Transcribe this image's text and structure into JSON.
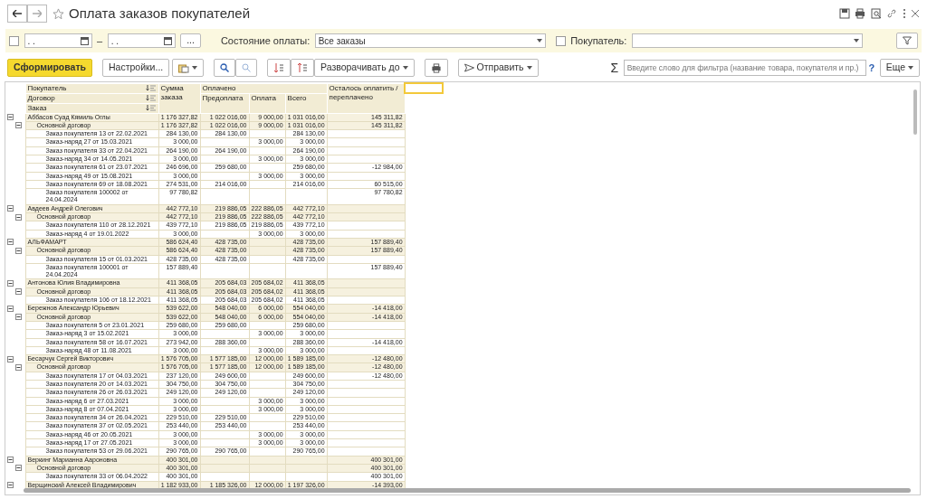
{
  "window": {
    "title": "Оплата заказов покупателей"
  },
  "filters": {
    "period_enabled": false,
    "date_from": ". .",
    "date_separator": "–",
    "period_button": "...",
    "payment_state_label": "Состояние оплаты:",
    "payment_state": "Все заказы",
    "customer_enabled": false,
    "customer_label": "Покупатель:"
  },
  "toolbar": {
    "generate": "Сформировать",
    "settings": "Настройки...",
    "expand_to": "Разворачивать до",
    "send": "Отправить",
    "sum_sign": "Σ",
    "search_placeholder": "Введите слово для фильтра (название товара, покупателя и пр.)",
    "help": "?",
    "more": "Еще"
  },
  "columns": {
    "grouping": [
      "Покупатель",
      "Договор",
      "Заказ"
    ],
    "order_sum": "Сумма заказа",
    "paid": "Оплачено",
    "paid_parts": [
      "Предоплата",
      "Оплата",
      "Всего"
    ],
    "remaining": "Осталось оплатить / переплачено"
  },
  "rows": [
    {
      "name": "Аббасов Суад Кямиль Оглы",
      "expanded": true,
      "sum": "1 176 327,82",
      "prepaid": "1 022 016,00",
      "paid": "9 000,00",
      "total": "1 031 016,00",
      "remaining": "145 311,82",
      "children": [
        {
          "name": "Основной договор",
          "expanded": true,
          "sum": "1 176 327,82",
          "prepaid": "1 022 016,00",
          "paid": "9 000,00",
          "total": "1 031 016,00",
          "remaining": "145 311,82",
          "children": [
            {
              "name": "Заказ покупателя 13 от 22.02.2021",
              "sum": "284 130,00",
              "prepaid": "284 130,00",
              "total": "284 130,00"
            },
            {
              "name": "Заказ-наряд 27 от 15.03.2021",
              "sum": "3 000,00",
              "paid": "3 000,00",
              "total": "3 000,00"
            },
            {
              "name": "Заказ покупателя 33 от 22.04.2021",
              "sum": "264 190,00",
              "prepaid": "264 190,00",
              "total": "264 190,00"
            },
            {
              "name": "Заказ-наряд 34 от 14.05.2021",
              "sum": "3 000,00",
              "paid": "3 000,00",
              "total": "3 000,00"
            },
            {
              "name": "Заказ покупателя 61 от 23.07.2021",
              "sum": "246 696,00",
              "prepaid": "259 680,00",
              "total": "259 680,00",
              "remaining": "-12 984,00"
            },
            {
              "name": "Заказ-наряд 49 от 15.08.2021",
              "sum": "3 000,00",
              "paid": "3 000,00",
              "total": "3 000,00"
            },
            {
              "name": "Заказ покупателя 69 от 18.08.2021",
              "sum": "274 531,00",
              "prepaid": "214 016,00",
              "total": "214 016,00",
              "remaining": "60 515,00"
            },
            {
              "name": "Заказ покупателя 100002 от 24.04.2024",
              "sum": "97 780,82",
              "remaining": "97 780,82"
            }
          ]
        }
      ]
    },
    {
      "name": "Авдеев Андрей Олегович",
      "expanded": true,
      "sum": "442 772,10",
      "prepaid": "219 886,05",
      "paid": "222 886,05",
      "total": "442 772,10",
      "children": [
        {
          "name": "Основной договор",
          "expanded": true,
          "sum": "442 772,10",
          "prepaid": "219 886,05",
          "paid": "222 886,05",
          "total": "442 772,10",
          "children": [
            {
              "name": "Заказ покупателя 110 от 28.12.2021",
              "sum": "439 772,10",
              "prepaid": "219 886,05",
              "paid": "219 886,05",
              "total": "439 772,10"
            },
            {
              "name": "Заказ-наряд 4 от 19.01.2022",
              "sum": "3 000,00",
              "paid": "3 000,00",
              "total": "3 000,00"
            }
          ]
        }
      ]
    },
    {
      "name": "АЛЬФАМАРТ",
      "expanded": true,
      "sum": "586 624,40",
      "prepaid": "428 735,00",
      "total": "428 735,00",
      "remaining": "157 889,40",
      "children": [
        {
          "name": "Основной договор",
          "expanded": true,
          "sum": "586 624,40",
          "prepaid": "428 735,00",
          "total": "428 735,00",
          "remaining": "157 889,40",
          "children": [
            {
              "name": "Заказ покупателя 15 от 01.03.2021",
              "sum": "428 735,00",
              "prepaid": "428 735,00",
              "total": "428 735,00"
            },
            {
              "name": "Заказ покупателя 100001 от 24.04.2024",
              "sum": "157 889,40",
              "remaining": "157 889,40"
            }
          ]
        }
      ]
    },
    {
      "name": "Антонова Юлия Владимировна",
      "expanded": true,
      "sum": "411 368,05",
      "prepaid": "205 684,03",
      "paid": "205 684,02",
      "total": "411 368,05",
      "children": [
        {
          "name": "Основной договор",
          "expanded": true,
          "sum": "411 368,05",
          "prepaid": "205 684,03",
          "paid": "205 684,02",
          "total": "411 368,05",
          "children": [
            {
              "name": "Заказ покупателя 106 от 18.12.2021",
              "sum": "411 368,05",
              "prepaid": "205 684,03",
              "paid": "205 684,02",
              "total": "411 368,05"
            }
          ]
        }
      ]
    },
    {
      "name": "Бережнов Александр Юрьевич",
      "expanded": true,
      "sum": "539 622,00",
      "prepaid": "548 040,00",
      "paid": "6 000,00",
      "total": "554 040,00",
      "remaining": "-14 418,00",
      "children": [
        {
          "name": "Основной договор",
          "expanded": true,
          "sum": "539 622,00",
          "prepaid": "548 040,00",
          "paid": "6 000,00",
          "total": "554 040,00",
          "remaining": "-14 418,00",
          "children": [
            {
              "name": "Заказ покупателя 5 от 23.01.2021",
              "sum": "259 680,00",
              "prepaid": "259 680,00",
              "total": "259 680,00"
            },
            {
              "name": "Заказ-наряд 3 от 15.02.2021",
              "sum": "3 000,00",
              "paid": "3 000,00",
              "total": "3 000,00"
            },
            {
              "name": "Заказ покупателя 58 от 16.07.2021",
              "sum": "273 942,00",
              "prepaid": "288 360,00",
              "total": "288 360,00",
              "remaining": "-14 418,00"
            },
            {
              "name": "Заказ-наряд 48 от 11.08.2021",
              "sum": "3 000,00",
              "paid": "3 000,00",
              "total": "3 000,00"
            }
          ]
        }
      ]
    },
    {
      "name": "Бесарчук Сергей Викторович",
      "expanded": true,
      "sum": "1 576 705,00",
      "prepaid": "1 577 185,00",
      "paid": "12 000,00",
      "total": "1 589 185,00",
      "remaining": "-12 480,00",
      "children": [
        {
          "name": "Основной договор",
          "expanded": true,
          "sum": "1 576 705,00",
          "prepaid": "1 577 185,00",
          "paid": "12 000,00",
          "total": "1 589 185,00",
          "remaining": "-12 480,00",
          "children": [
            {
              "name": "Заказ покупателя 17 от 04.03.2021",
              "sum": "237 120,00",
              "prepaid": "249 600,00",
              "total": "249 600,00",
              "remaining": "-12 480,00"
            },
            {
              "name": "Заказ покупателя 20 от 14.03.2021",
              "sum": "304 750,00",
              "prepaid": "304 750,00",
              "total": "304 750,00"
            },
            {
              "name": "Заказ покупателя 26 от 26.03.2021",
              "sum": "249 120,00",
              "prepaid": "249 120,00",
              "total": "249 120,00"
            },
            {
              "name": "Заказ-наряд 6 от 27.03.2021",
              "sum": "3 000,00",
              "paid": "3 000,00",
              "total": "3 000,00"
            },
            {
              "name": "Заказ-наряд 8 от 07.04.2021",
              "sum": "3 000,00",
              "paid": "3 000,00",
              "total": "3 000,00"
            },
            {
              "name": "Заказ покупателя 34 от 26.04.2021",
              "sum": "229 510,00",
              "prepaid": "229 510,00",
              "total": "229 510,00"
            },
            {
              "name": "Заказ покупателя 37 от 02.05.2021",
              "sum": "253 440,00",
              "prepaid": "253 440,00",
              "total": "253 440,00"
            },
            {
              "name": "Заказ-наряд 46 от 20.05.2021",
              "sum": "3 000,00",
              "paid": "3 000,00",
              "total": "3 000,00"
            },
            {
              "name": "Заказ-наряд 17 от 27.05.2021",
              "sum": "3 000,00",
              "paid": "3 000,00",
              "total": "3 000,00"
            },
            {
              "name": "Заказ покупателя 53 от 29.06.2021",
              "sum": "290 765,00",
              "prepaid": "290 765,00",
              "total": "290 765,00"
            }
          ]
        }
      ]
    },
    {
      "name": "Веркинг Марианна Аароновна",
      "expanded": true,
      "sum": "400 301,00",
      "remaining": "400 301,00",
      "children": [
        {
          "name": "Основной договор",
          "expanded": true,
          "sum": "400 301,00",
          "remaining": "400 301,00",
          "children": [
            {
              "name": "Заказ покупателя 33 от 06.04.2022",
              "sum": "400 301,00",
              "remaining": "400 301,00"
            }
          ]
        }
      ]
    },
    {
      "name": "Верщинский Алексей Владимирович",
      "expanded": true,
      "sum": "1 182 933,00",
      "prepaid": "1 185 326,00",
      "paid": "12 000,00",
      "total": "1 197 326,00",
      "remaining": "-14 393,00"
    }
  ]
}
